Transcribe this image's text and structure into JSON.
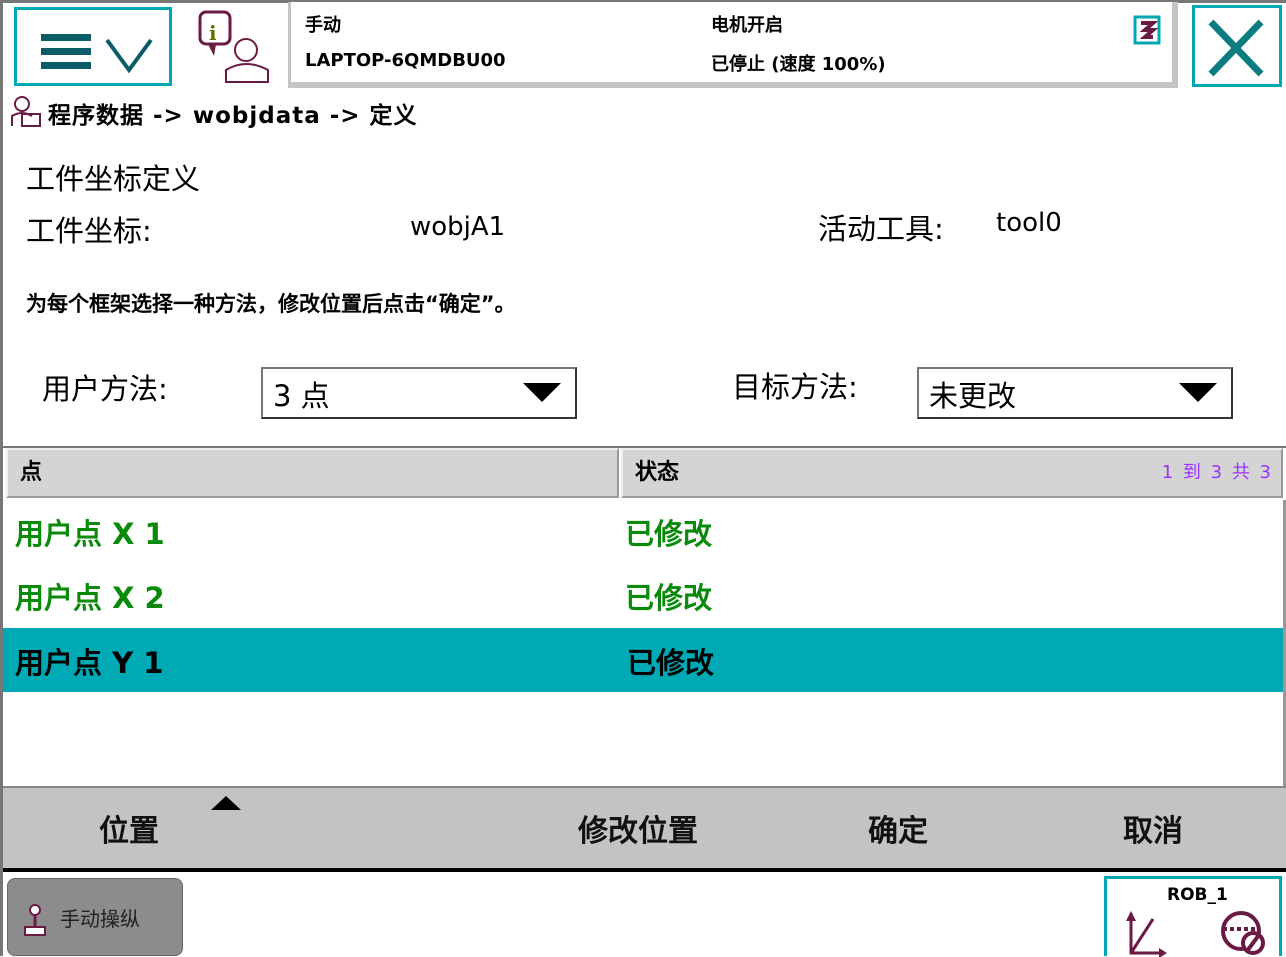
{
  "header": {
    "mode": "手动",
    "controller": "LAPTOP-6QMDBU00",
    "motor_state": "电机开启",
    "run_state": "已停止 (速度 100%)"
  },
  "breadcrumb": "程序数据 -> wobjdata -> 定义",
  "page": {
    "title": "工件坐标定义",
    "wobj_label": "工件坐标:",
    "wobj_value": "wobjA1",
    "tool_label": "活动工具:",
    "tool_value": "tool0",
    "instruction": "为每个框架选择一种方法，修改位置后点击“确定”。",
    "user_method_label": "用户方法:",
    "user_method_value": "3 点",
    "target_method_label": "目标方法:",
    "target_method_value": "未更改"
  },
  "table": {
    "headers": [
      "点",
      "状态"
    ],
    "pager": "1 到 3 共 3",
    "rows": [
      {
        "point": "用户点 X 1",
        "status": "已修改"
      },
      {
        "point": "用户点 X 2",
        "status": "已修改"
      },
      {
        "point": "用户点 Y 1",
        "status": "已修改",
        "selected": true
      }
    ]
  },
  "toolbar": {
    "position": "位置",
    "modify_position": "修改位置",
    "ok": "确定",
    "cancel": "取消"
  },
  "taskbar": {
    "jog": "手动操纵",
    "robot": "ROB_1"
  },
  "colors": {
    "accent": "#00a8b4",
    "modified": "#0a8a0a",
    "icon": "#6b1a44",
    "pager": "#9933ff"
  }
}
